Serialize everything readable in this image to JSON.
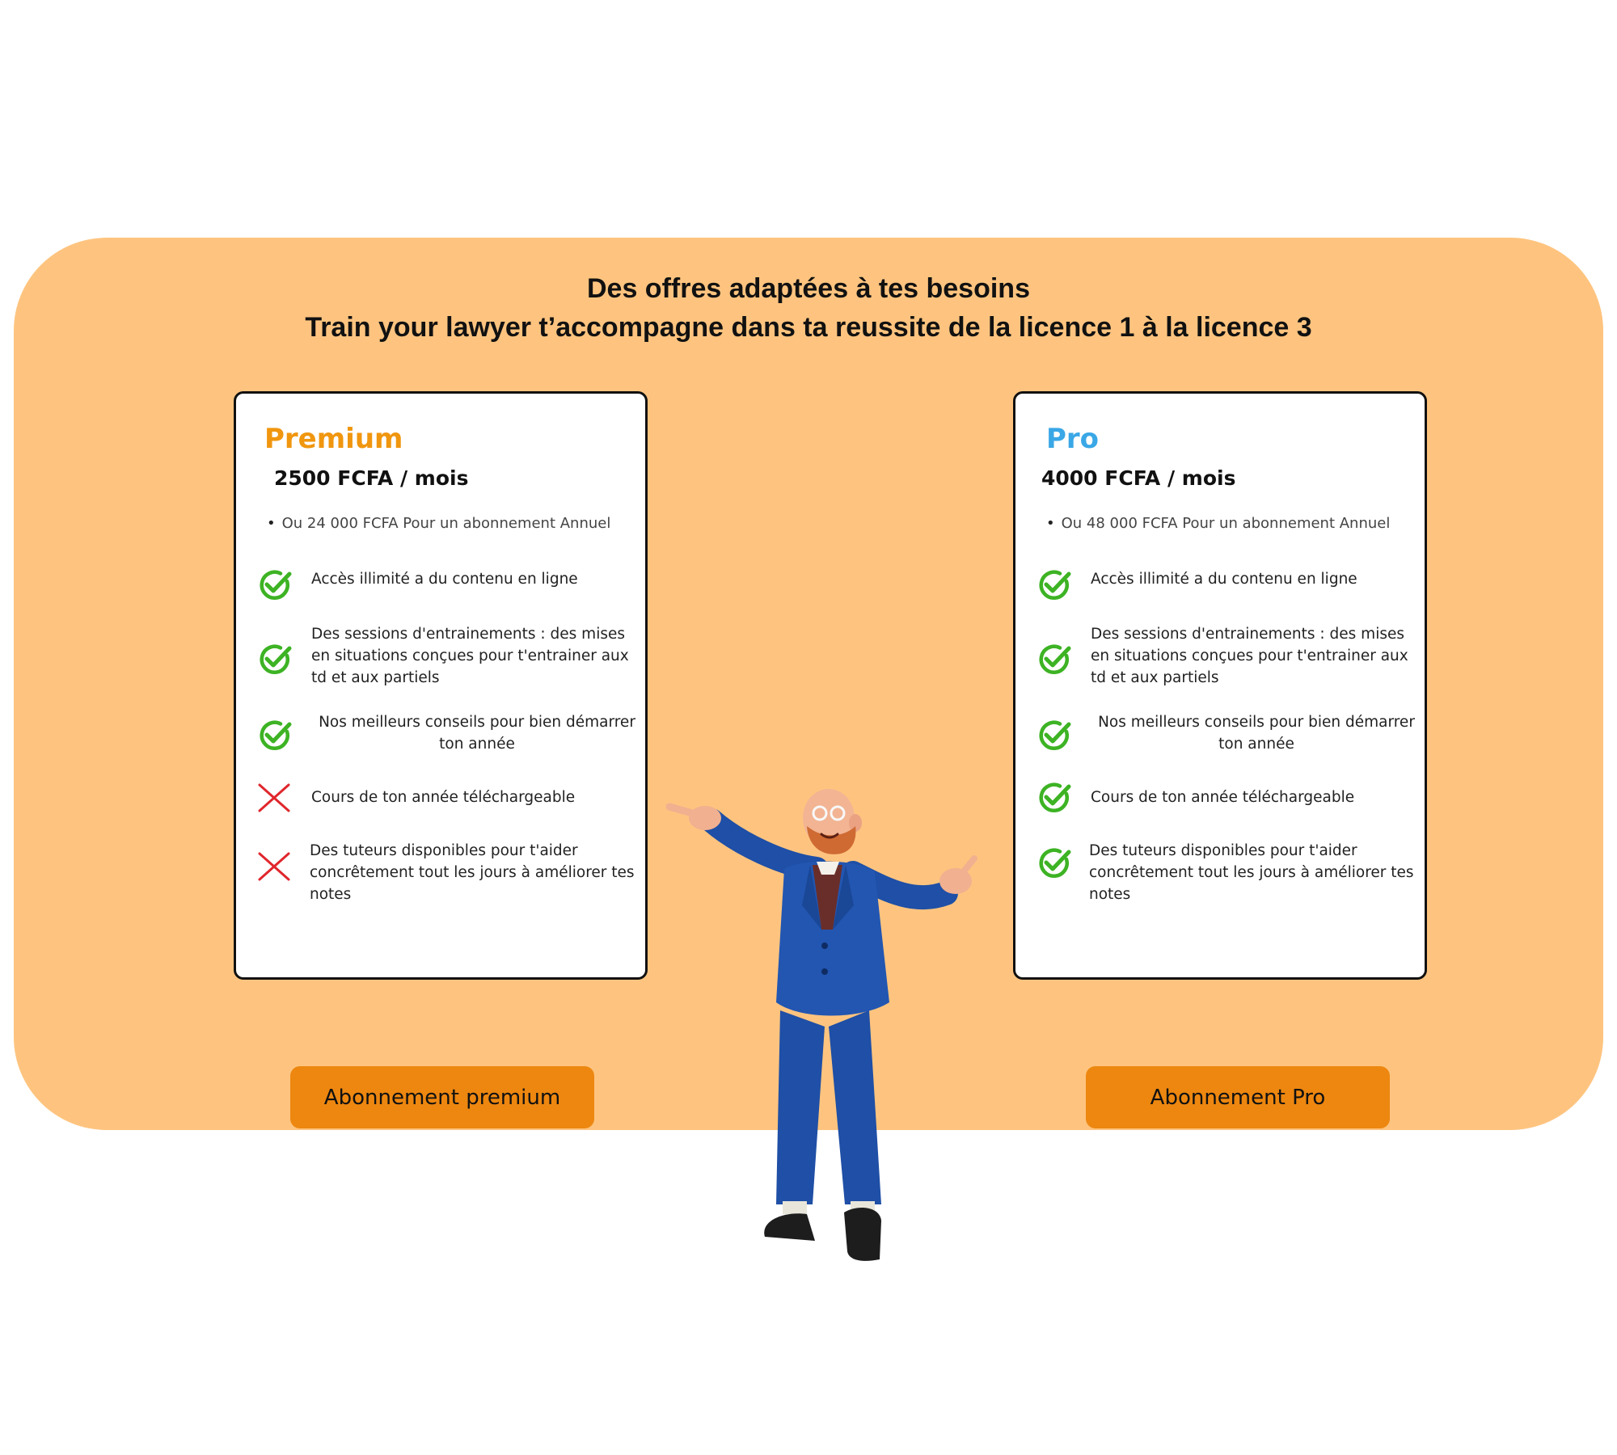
{
  "header": {
    "line1": "Des offres adaptées à tes besoins",
    "line2": "Train your lawyer t’accompagne dans ta reussite de la licence 1 à la licence 3"
  },
  "colors": {
    "panel": "#fec47f",
    "button": "#ed8710",
    "premium_title": "#f0960f",
    "pro_title": "#3aa7e6",
    "check": "#3db324",
    "cross": "#e0262c"
  },
  "plans": [
    {
      "name": "Premium",
      "price": "2500 FCFA / mois",
      "annual": "Ou 24 000 FCFA Pour un abonnement Annuel",
      "features": [
        {
          "text": "Accès illimité a du contenu en ligne",
          "icon": "check-icon"
        },
        {
          "text": "Des sessions d'entrainements : des mises en situations conçues pour t'entrainer aux td et aux partiels",
          "icon": "check-icon"
        },
        {
          "text": "Nos meilleurs conseils pour bien démarrer ton année",
          "icon": "check-icon"
        },
        {
          "text": "Cours de ton année téléchargeable",
          "icon": "cross-icon"
        },
        {
          "text": "Des tuteurs disponibles pour t'aider concrêtement tout les jours à améliorer tes notes",
          "icon": "cross-icon"
        }
      ],
      "button": "Abonnement premium"
    },
    {
      "name": "Pro",
      "price": "4000 FCFA / mois",
      "annual": "Ou 48 000 FCFA Pour un abonnement Annuel",
      "features": [
        {
          "text": "Accès illimité a du contenu en ligne",
          "icon": "check-icon"
        },
        {
          "text": "Des sessions d'entrainements : des mises en situations conçues pour t'entrainer aux td et aux partiels",
          "icon": "check-icon"
        },
        {
          "text": "Nos meilleurs conseils pour bien démarrer ton année",
          "icon": "check-icon"
        },
        {
          "text": "Cours de ton année téléchargeable",
          "icon": "check-icon"
        },
        {
          "text": "Des tuteurs disponibles pour t'aider concrêtement tout les jours à améliorer tes notes",
          "icon": "check-icon"
        }
      ],
      "button": "Abonnement Pro"
    }
  ]
}
